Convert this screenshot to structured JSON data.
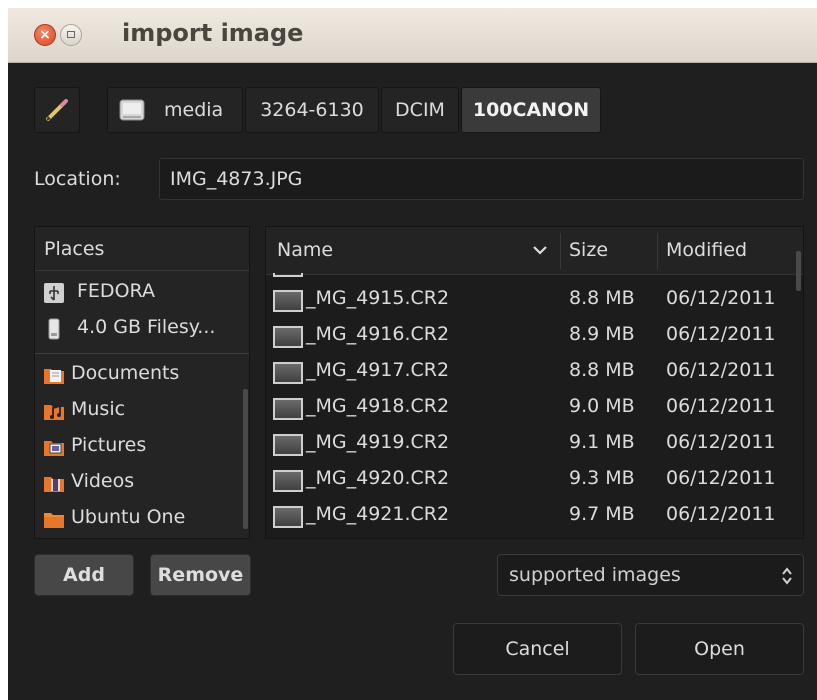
{
  "window": {
    "title": "import image",
    "close_glyph": "×"
  },
  "pathbar": {
    "items": [
      {
        "label": "",
        "icon": "pencil-icon"
      },
      {
        "label": "media",
        "icon": "drive-icon"
      },
      {
        "label": "3264-6130"
      },
      {
        "label": "DCIM"
      },
      {
        "label": "100CANON",
        "active": true
      }
    ]
  },
  "location": {
    "label": "Location:",
    "value": "IMG_4873.JPG"
  },
  "places": {
    "header": "Places",
    "items": [
      {
        "label": "FEDORA",
        "icon": "usb-drive-icon"
      },
      {
        "label": "4.0 GB Filesy...",
        "icon": "removable-disk-icon"
      },
      {
        "label": "Documents",
        "icon": "documents-folder-icon"
      },
      {
        "label": "Music",
        "icon": "music-folder-icon"
      },
      {
        "label": "Pictures",
        "icon": "pictures-folder-icon"
      },
      {
        "label": "Videos",
        "icon": "videos-folder-icon"
      },
      {
        "label": "Ubuntu One",
        "icon": "ubuntu-one-folder-icon"
      }
    ]
  },
  "files": {
    "columns": {
      "name": "Name",
      "size": "Size",
      "modified": "Modified"
    },
    "rows": [
      {
        "name": "_MG_4915.CR2",
        "size": "8.8 MB",
        "modified": "06/12/2011"
      },
      {
        "name": "_MG_4916.CR2",
        "size": "8.9 MB",
        "modified": "06/12/2011"
      },
      {
        "name": "_MG_4917.CR2",
        "size": "8.8 MB",
        "modified": "06/12/2011"
      },
      {
        "name": "_MG_4918.CR2",
        "size": "9.0 MB",
        "modified": "06/12/2011"
      },
      {
        "name": "_MG_4919.CR2",
        "size": "9.1 MB",
        "modified": "06/12/2011"
      },
      {
        "name": "_MG_4920.CR2",
        "size": "9.3 MB",
        "modified": "06/12/2011"
      },
      {
        "name": "_MG_4921.CR2",
        "size": "9.7 MB",
        "modified": "06/12/2011"
      }
    ]
  },
  "buttons": {
    "add": "Add",
    "remove": "Remove",
    "cancel": "Cancel",
    "open": "Open"
  },
  "filter": {
    "selected": "supported images"
  },
  "colors": {
    "dialog_bg": "#1f1f1f",
    "titlebar_bg": "#e6e0d7",
    "close_button": "#e0582f",
    "text": "#dcdcdc"
  }
}
